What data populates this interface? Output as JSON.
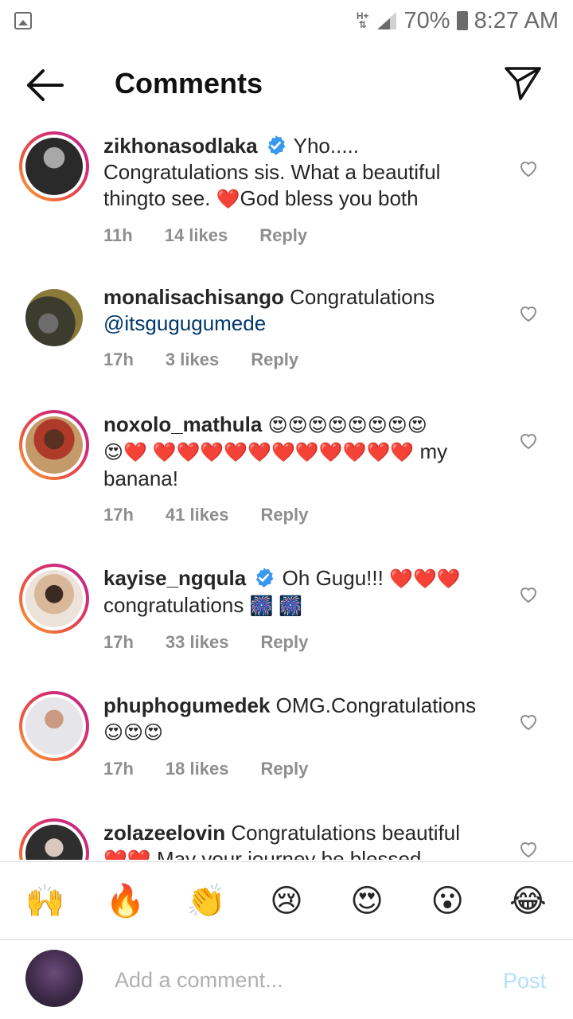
{
  "status_bar": {
    "network": "H+",
    "battery_percent": "70%",
    "time": "8:27 AM"
  },
  "header": {
    "title": "Comments",
    "back_icon": "arrow-left-icon",
    "send_icon": "paper-plane-icon"
  },
  "comments": [
    {
      "username": "zikhonasodlaka",
      "verified": true,
      "text_parts": [
        {
          "t": "Yho.....\nCongratulations sis. What a beautiful\nthingto see. "
        },
        {
          "emoji": "❤️"
        },
        {
          "t": "God bless you both"
        }
      ],
      "time": "11h",
      "likes": "14 likes",
      "reply": "Reply"
    },
    {
      "username": "monalisachisango",
      "verified": false,
      "text": "Congratulations",
      "mention": "@itsgugugumede",
      "time": "17h",
      "likes": "3 likes",
      "reply": "Reply"
    },
    {
      "username": "noxolo_mathula",
      "verified": false,
      "emojis_line1": "😍😍😍😍😍😍😍😍",
      "emojis_line2": "😍❤️ ❤️❤️❤️❤️❤️❤️❤️❤️❤️❤️❤️",
      "text": " my banana!",
      "time": "17h",
      "likes": "41 likes",
      "reply": "Reply"
    },
    {
      "username": "kayise_ngqula",
      "verified": true,
      "text": "Oh Gugu!!! ",
      "emojis": "❤️❤️❤️",
      "text2": "congratulations ",
      "emojis2": "🎆 🎆",
      "time": "17h",
      "likes": "33 likes",
      "reply": "Reply"
    },
    {
      "username": "phuphogumedek",
      "verified": false,
      "text": "OMG.Congratulations",
      "emojis": "😍😍😍",
      "time": "17h",
      "likes": "18 likes",
      "reply": "Reply"
    },
    {
      "username": "zolazeelovin",
      "verified": false,
      "text": "Congratulations beautiful",
      "emojis": "❤️❤️",
      "text2": " May your journey be blessed"
    }
  ],
  "emoji_bar": [
    "🙌",
    "🔥",
    "👏",
    "😢",
    "😍",
    "😮",
    "😂"
  ],
  "input": {
    "placeholder": "Add a comment...",
    "post_label": "Post"
  },
  "colors": {
    "text": "#262626",
    "meta": "#8e8e8e",
    "mention": "#00376b",
    "verified": "#3897f0",
    "post_disabled": "#b2dffc"
  }
}
